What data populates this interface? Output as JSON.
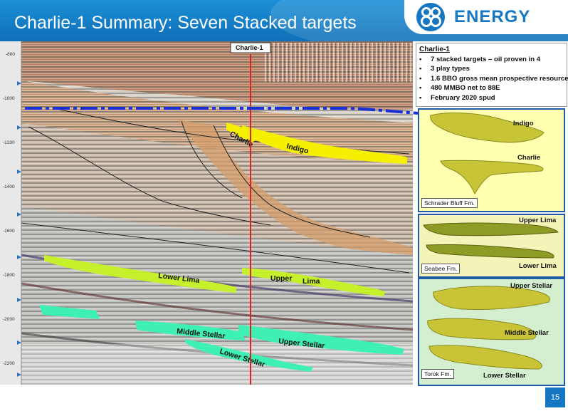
{
  "slide": {
    "title": "Charlie-1 Summary: Seven Stacked targets",
    "page_number": "15"
  },
  "logo": {
    "text": "ENERGY",
    "brand_color": "#1577c2"
  },
  "seismic": {
    "well_name": "Charlie-1",
    "depth_ticks": [
      "-800",
      "-1000",
      "-1200",
      "-1400",
      "-1600",
      "-1800",
      "-2000",
      "-2200"
    ],
    "targets": {
      "charlie": "Charlie",
      "indigo": "Indigo",
      "lower_lima": "Lower Lima",
      "upper_lima_a": "Upper",
      "upper_lima_b": "Lima",
      "middle_stellar": "Middle Stellar",
      "upper_stellar": "Upper Stellar",
      "lower_stellar": "Lower Stellar"
    },
    "colors": {
      "indigo_charlie": "#f4f000",
      "lima": "#c6ef2c",
      "stellar": "#3ff0b4",
      "well": "#e02020",
      "marker": "#1a2fd8"
    }
  },
  "info": {
    "title": "Charlie-1",
    "bullets": [
      "7 stacked targets – oil proven in 4",
      "3 play types",
      "1.6 BBO gross mean prospective resource",
      "480 MMBO net to 88E",
      "February 2020 spud"
    ]
  },
  "panels": {
    "schrader": {
      "formation": "Schrader Bluff Fm.",
      "labels": [
        "Indigo",
        "Charlie"
      ]
    },
    "seabee": {
      "formation": "Seabee Fm.",
      "labels": [
        "Upper Lima",
        "Lower Lima"
      ]
    },
    "torok": {
      "formation": "Torok Fm.",
      "labels": [
        "Upper Stellar",
        "Middle Stellar",
        "Lower Stellar"
      ]
    }
  }
}
